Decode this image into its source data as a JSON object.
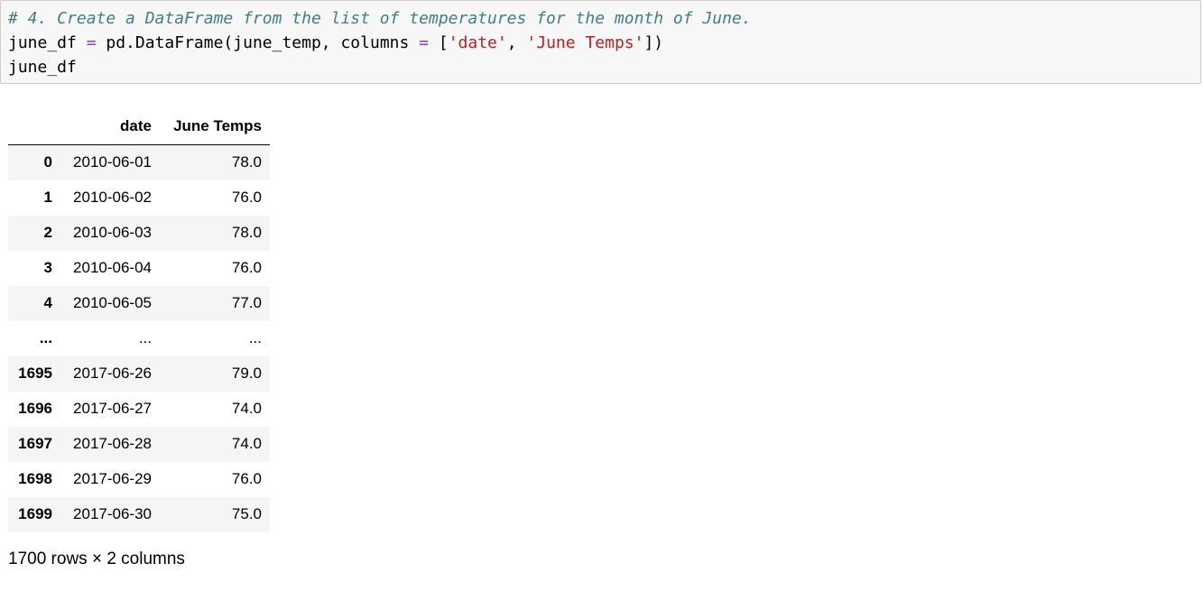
{
  "code_cell": {
    "lines": [
      [
        {
          "cls": "tok-comment",
          "text": "# 4. Create a DataFrame from the list of temperatures for the month of June."
        }
      ],
      [
        {
          "cls": "",
          "text": "june_df "
        },
        {
          "cls": "tok-op",
          "text": "="
        },
        {
          "cls": "",
          "text": " pd.DataFrame(june_temp, columns "
        },
        {
          "cls": "tok-op",
          "text": "="
        },
        {
          "cls": "",
          "text": " ["
        },
        {
          "cls": "tok-str",
          "text": "'date'"
        },
        {
          "cls": "",
          "text": ", "
        },
        {
          "cls": "tok-str",
          "text": "'June Temps'"
        },
        {
          "cls": "",
          "text": "])"
        }
      ],
      [
        {
          "cls": "",
          "text": "june_df"
        }
      ]
    ]
  },
  "dataframe": {
    "columns": [
      "date",
      "June Temps"
    ],
    "rows": [
      {
        "index": "0",
        "date": "2010-06-01",
        "temp": "78.0"
      },
      {
        "index": "1",
        "date": "2010-06-02",
        "temp": "76.0"
      },
      {
        "index": "2",
        "date": "2010-06-03",
        "temp": "78.0"
      },
      {
        "index": "3",
        "date": "2010-06-04",
        "temp": "76.0"
      },
      {
        "index": "4",
        "date": "2010-06-05",
        "temp": "77.0"
      },
      {
        "index": "...",
        "date": "...",
        "temp": "..."
      },
      {
        "index": "1695",
        "date": "2017-06-26",
        "temp": "79.0"
      },
      {
        "index": "1696",
        "date": "2017-06-27",
        "temp": "74.0"
      },
      {
        "index": "1697",
        "date": "2017-06-28",
        "temp": "74.0"
      },
      {
        "index": "1698",
        "date": "2017-06-29",
        "temp": "76.0"
      },
      {
        "index": "1699",
        "date": "2017-06-30",
        "temp": "75.0"
      }
    ],
    "shape_note": "1700 rows × 2 columns"
  }
}
